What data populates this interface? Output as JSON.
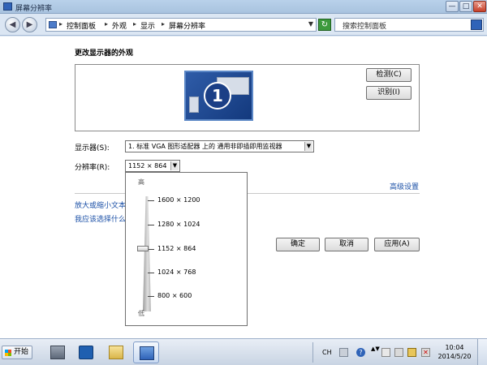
{
  "window": {
    "title": "屏幕分辨率",
    "min_label": "—",
    "max_label": "□",
    "close_label": "✕"
  },
  "addressbar": {
    "breadcrumb": [
      "控制面板",
      "外观",
      "显示",
      "屏幕分辨率"
    ],
    "search_placeholder": "搜索控制面板"
  },
  "main": {
    "heading": "更改显示器的外观",
    "monitor_number": "1",
    "detect_button": "检测(C)",
    "identify_button": "识别(I)",
    "display_label": "显示器(S):",
    "display_value": "1. 标准 VGA 图形适配器 上的 通用非即插即用监视器",
    "resolution_label": "分辨率(R):",
    "resolution_value": "1152 × 864",
    "advanced_link": "高级设置",
    "link_text_size": "放大或缩小文本",
    "link_which_settings": "我应该选择什么",
    "ok_button": "确定",
    "cancel_button": "取消",
    "apply_button": "应用(A)"
  },
  "resolution_slider": {
    "high_label": "高",
    "low_label": "低",
    "options": [
      "1600 × 1200",
      "1280 × 1024",
      "1152 × 864",
      "1024 × 768",
      "800 × 600"
    ],
    "selected": "1152 × 864"
  },
  "taskbar": {
    "start_label": "开始",
    "apps": [
      "server-manager-icon",
      "powershell-icon",
      "explorer-icon",
      "control-panel-icon"
    ],
    "active_app": "control-panel-icon",
    "lang": "CH",
    "time": "10:04",
    "date": "2014/5/20"
  },
  "colors": {
    "link": "#1a4fa6",
    "titlebar": "#b9d1ea",
    "monitor_bg": "#2f5ca8"
  }
}
